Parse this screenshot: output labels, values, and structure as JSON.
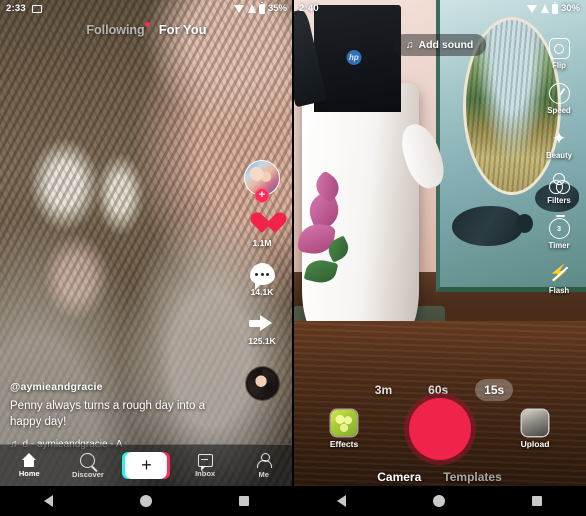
{
  "left_phone": {
    "status_bar": {
      "time": "2:33",
      "cast_icon": "screencast-icon",
      "wifi_icon": "wifi-icon",
      "signal_icon": "signal-icon",
      "battery_icon": "battery-icon",
      "battery_pct": "35%"
    },
    "top_tabs": [
      {
        "label": "Following",
        "active": false,
        "has_dot": true
      },
      {
        "label": "For You",
        "active": true,
        "has_dot": false
      }
    ],
    "action_rail": {
      "avatar": "creator-avatar",
      "follow_label": "+",
      "items": [
        {
          "icon": "heart-icon",
          "count": "1.1M"
        },
        {
          "icon": "comment-icon",
          "count": "14.1K"
        },
        {
          "icon": "share-icon",
          "count": "125.1K"
        }
      ],
      "disc": "spinning-record-icon"
    },
    "caption": {
      "username": "@aymieandgracie",
      "text": "Penny always turns a rough day into a happy day!",
      "music_note": "♫",
      "music": "d - aymieandgracie - A"
    },
    "bottom_nav": [
      {
        "label": "Home",
        "icon": "home-icon",
        "active": true
      },
      {
        "label": "Discover",
        "icon": "search-icon",
        "active": false
      },
      {
        "label": "+",
        "icon": "create-icon",
        "active": false
      },
      {
        "label": "Inbox",
        "icon": "inbox-icon",
        "active": false
      },
      {
        "label": "Me",
        "icon": "profile-icon",
        "active": false
      }
    ]
  },
  "right_phone": {
    "status_bar": {
      "time": "2:40",
      "wifi_icon": "wifi-icon",
      "signal_icon": "signal-icon",
      "battery_icon": "battery-icon",
      "battery_pct": "30%"
    },
    "add_sound": {
      "note": "♫",
      "label": "Add sound"
    },
    "close_icon": "camera-switch-icon",
    "tool_rail": [
      {
        "label": "Flip",
        "icon": "flip-camera-icon"
      },
      {
        "label": "Speed",
        "icon": "speed-icon"
      },
      {
        "label": "Beauty",
        "icon": "beauty-wand-icon"
      },
      {
        "label": "Filters",
        "icon": "filters-icon"
      },
      {
        "label": "Timer",
        "icon": "timer-icon",
        "badge": "3"
      },
      {
        "label": "Flash",
        "icon": "flash-off-icon"
      }
    ],
    "durations": [
      {
        "label": "3m",
        "selected": false
      },
      {
        "label": "60s",
        "selected": false
      },
      {
        "label": "15s",
        "selected": true
      }
    ],
    "controls": {
      "effects_label": "Effects",
      "effects_icon": "effects-icon",
      "record_icon": "record-button",
      "record_color": "#f0234a",
      "upload_label": "Upload",
      "upload_icon": "upload-thumbnail"
    },
    "mode_tabs": [
      {
        "label": "Camera",
        "active": true
      },
      {
        "label": "Templates",
        "active": false
      }
    ]
  },
  "android_nav": {
    "back": "back-icon",
    "home": "home-icon",
    "recents": "recents-icon"
  },
  "colors": {
    "accent_pink": "#fe2c55",
    "accent_cyan": "#25f4ee",
    "record_red": "#f0234a"
  }
}
